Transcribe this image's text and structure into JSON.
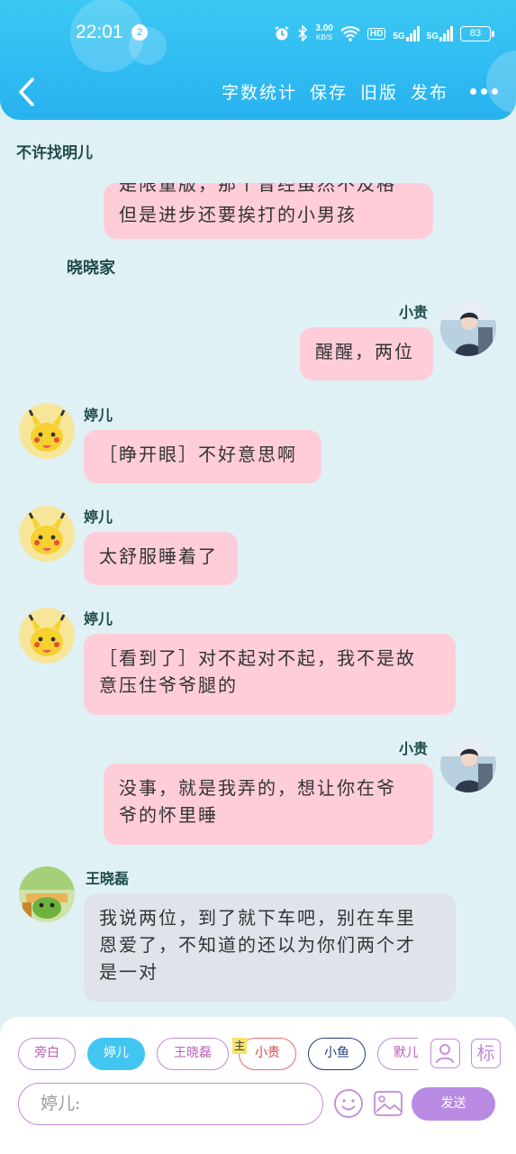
{
  "status_bar": {
    "time": "22:01",
    "notification_count": "2",
    "net_speed_value": "3.00",
    "net_speed_unit": "KB/S",
    "hd_label": "HD",
    "signal1_label": "5G",
    "signal2_label": "5G",
    "battery": "83"
  },
  "toolbar": {
    "word_count": "字数统计",
    "save": "保存",
    "old_version": "旧版",
    "publish": "发布"
  },
  "chat": {
    "scene1_title": "不许找明儿",
    "scene1_cut_line": "是限量版，那个曾经虽然不及格",
    "scene1_last_line": "但是进步还要挨打的小男孩",
    "scene2_title": "晓晓家",
    "messages": [
      {
        "sender": "小贵",
        "text": "醒醒，两位"
      },
      {
        "sender": "婷儿",
        "text": "［睁开眼］不好意思啊"
      },
      {
        "sender": "婷儿",
        "text": "太舒服睡着了"
      },
      {
        "sender": "婷儿",
        "line1": "［看到了］对不起对不起，我不是故",
        "line2": "意压住爷爷腿的"
      },
      {
        "sender": "小贵",
        "line1": "没事，就是我弄的，想让你在爷",
        "line2": "爷的怀里睡"
      },
      {
        "sender": "王晓磊",
        "line1": "我说两位，到了就下车吧，别在车里",
        "line2": "恩爱了，不知道的还以为你们两个才",
        "line3": "是一对"
      }
    ]
  },
  "characters": {
    "items": [
      "旁白",
      "婷儿",
      "王晓磊",
      "小贵",
      "小鱼",
      "默儿"
    ],
    "selected": "婷儿",
    "main_tag": "主"
  },
  "composer": {
    "placeholder": "婷儿:",
    "send_label": "发送",
    "mark_label": "标"
  },
  "colors": {
    "header": "#27b2f0",
    "pink_bubble": "#ffcdd8",
    "gray_bubble": "#e0e3ea",
    "chip_border": "#c08ad6",
    "send_button": "#b98ae2",
    "background": "#dff1f5"
  }
}
